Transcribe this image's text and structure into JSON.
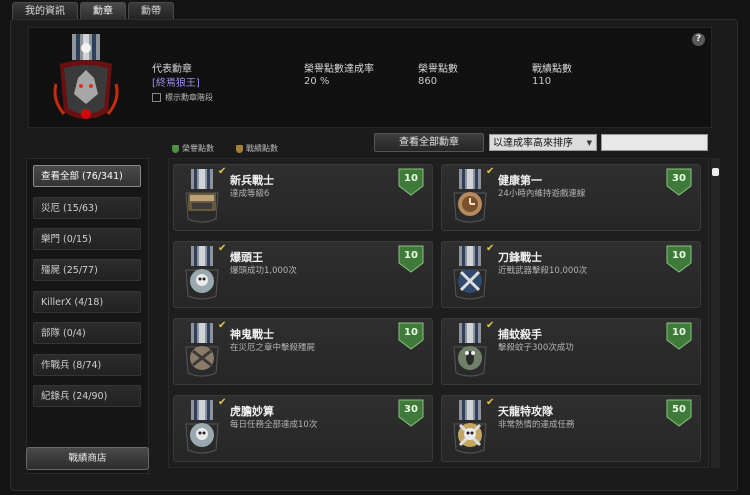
{
  "tabs": [
    "我的資訊",
    "勳章",
    "勳帶"
  ],
  "header": {
    "rep_label": "代表勳章",
    "rep_value": "[終焉狼王]",
    "show_label": "標示勳章階段",
    "glory_rate_label": "榮譽點數達成率",
    "glory_rate_value": "20 %",
    "glory_label": "榮譽點數",
    "glory_value": "860",
    "battle_label": "戰績點數",
    "battle_value": "110",
    "help": "?"
  },
  "legend": {
    "glory": "榮譽點數",
    "battle": "戰績點數"
  },
  "controls": {
    "view_all": "查看全部勳章",
    "sort": "以達成率高來排序"
  },
  "sidebar": {
    "items": [
      {
        "label": "查看全部 (76/341)"
      },
      {
        "label": "災厄 (15/63)"
      },
      {
        "label": "樂門 (0/15)"
      },
      {
        "label": "殭屍 (25/77)"
      },
      {
        "label": "KillerX (4/18)"
      },
      {
        "label": "部隊 (0/4)"
      },
      {
        "label": "作戰兵 (8/74)"
      },
      {
        "label": "紀錄兵 (24/90)"
      }
    ],
    "shop": "戰績商店"
  },
  "medals": [
    {
      "title": "新兵戰士",
      "desc": "達成等級6",
      "points": "10",
      "badge": "welcome"
    },
    {
      "title": "健康第一",
      "desc": "24小時內維持遊戲連線",
      "points": "30",
      "badge": "clock"
    },
    {
      "title": "爆頭王",
      "desc": "爆頭成功1,000次",
      "points": "10",
      "badge": "skull"
    },
    {
      "title": "刀鋒戰士",
      "desc": "近戰武器擊殺10,000次",
      "points": "10",
      "badge": "swords"
    },
    {
      "title": "神鬼戰士",
      "desc": "在災厄之章中擊殺殭屍",
      "points": "10",
      "badge": "guns"
    },
    {
      "title": "捕蚊殺手",
      "desc": "擊殺蚊子300次成功",
      "points": "10",
      "badge": "bug"
    },
    {
      "title": "虎膽妙算",
      "desc": "每日任務全部達成10次",
      "points": "30",
      "badge": "skull"
    },
    {
      "title": "天龍特攻隊",
      "desc": "非常熱情的達成任務",
      "points": "50",
      "badge": "skullx"
    }
  ],
  "colors": {
    "points_badge": "#3f7a3a",
    "highlight": "#9d8cf0",
    "check": "#e6c44a"
  }
}
